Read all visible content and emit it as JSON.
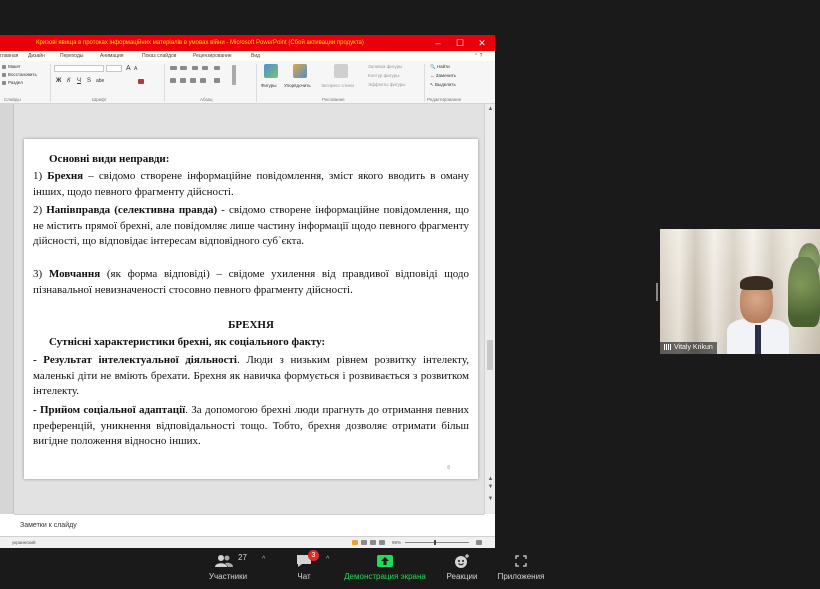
{
  "ppt": {
    "title": "Кризові явища в протоках інформаційних матеріалів в умовах війни  -  Microsoft PowerPoint (Сбой активации продукта)",
    "window_controls": {
      "minimize": "–",
      "maximize": "☐",
      "close": "✕"
    },
    "menu": [
      "главная",
      "Дизайн",
      "Переходы",
      "Анимация",
      "Показ слайдов",
      "Рецензирование",
      "Вид"
    ],
    "ribbon": {
      "slides_group": {
        "items": [
          "Макет",
          "Восстановить",
          "Раздел"
        ],
        "label": "Слайды"
      },
      "font_group": {
        "label": "Шрифт",
        "bold": "Ж",
        "italic": "К",
        "underline": "Ч",
        "strike": "S",
        "spacing": "abe",
        "grow": "A",
        "shrink": "A"
      },
      "paragraph_group": {
        "label": "Абзац"
      },
      "drawing_group": {
        "label": "Рисование",
        "shapes": "Фигуры",
        "arrange": "Упорядочить",
        "quick_styles": "Экспресс-стили",
        "fill": "Заливка фигуры",
        "outline": "Контур фигуры",
        "effects": "Эффекты фигуры"
      },
      "editing_group": {
        "label": "Редактирование",
        "find": "Найти",
        "replace": "Заменить",
        "select": "Выделить"
      }
    },
    "slide": {
      "heading1": "Основні види неправди:",
      "item1_num": "1) ",
      "item1_bold": "Брехня",
      "item1_text": " – свідомо створене інформаційне повідомлення, зміст якого вводить в оману інших, щодо певного фрагменту дійсності.",
      "item2_num": "2) ",
      "item2_bold": "Напівправда (селективна правда)",
      "item2_text": " -   свідомо створене інформаційне повідомлення, що не містить прямої брехні, але повідомляє лише частину інформації щодо певного фрагменту дійсності, що відповідає інтересам відповідного суб`єкта.",
      "item3_num": "3) ",
      "item3_bold": "Мовчання",
      "item3_text": " (як форма відповіді) – свідоме ухилення від правдивої відповіді щодо пізнавальної невизначеності стосовно певного фрагменту дійсності.",
      "heading2": "БРЕХНЯ",
      "heading3": "Сутнісні характеристики брехні, як соціального факту:",
      "item4_bold": "- Результат інтелектуальної діяльності",
      "item4_text": ". Люди з низьким рівнем розвитку інтелекту, маленькі діти не вміють брехати. Брехня як навичка формується і розвивається з розвитком інтелекту.",
      "item5_bold": "-  Прийом соціальної адаптації",
      "item5_text": ". За допомогою брехні люди прагнуть до отримання певних преференцій, уникнення відповідальності тощо. Тобто, брехня дозволяє отримати більш вигідне положення відносно інших.",
      "page_number": "8"
    },
    "notes_placeholder": "Заметки к слайду",
    "status": {
      "language": "украинский",
      "zoom": "98%"
    }
  },
  "video": {
    "participant_name": "Vitaly Krikun"
  },
  "toolbar": {
    "participants": {
      "label": "Участники",
      "count": "27"
    },
    "chat": {
      "label": "Чат",
      "badge": "3"
    },
    "share": {
      "label": "Демонстрация экрана"
    },
    "reactions": {
      "label": "Реакции"
    },
    "apps": {
      "label": "Приложения"
    }
  },
  "colors": {
    "titlebar": "#e8000b",
    "titlebar_text": "#ffd200",
    "share_green": "#23d959",
    "badge_red": "#e02a2a"
  }
}
